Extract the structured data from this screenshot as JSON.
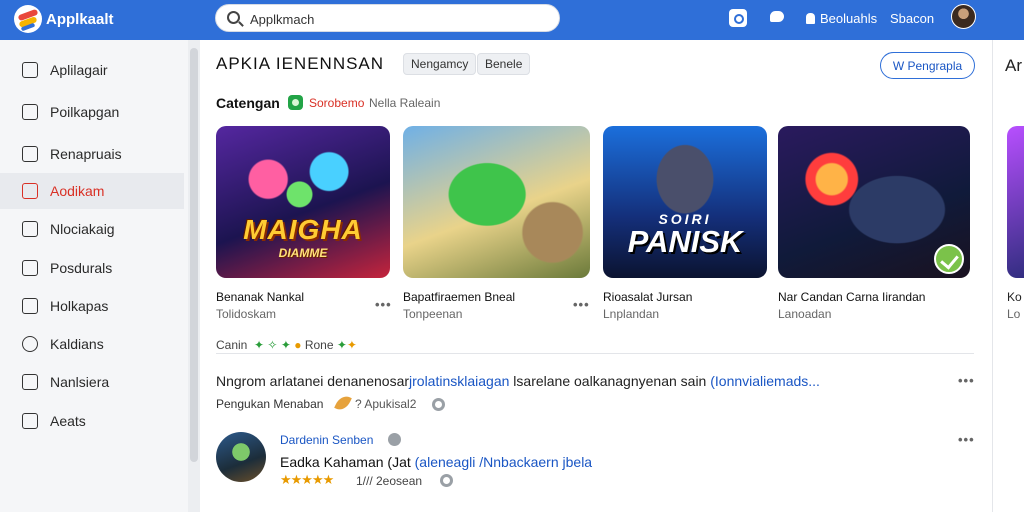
{
  "header": {
    "app_title": "Applkaalt",
    "search_value": "Applkmach",
    "links": [
      "Beoluahls",
      "Sbacon"
    ],
    "logo_icon": "app-logo-icon"
  },
  "sidebar": {
    "items": [
      {
        "label": "Aplilagair",
        "icon": "home-icon",
        "active": false
      },
      {
        "label": "Poilkapgan",
        "icon": "list-icon",
        "active": false
      },
      {
        "label": "Renapruais",
        "icon": "chart-icon",
        "active": false
      },
      {
        "label": "Aodikam",
        "icon": "apps-icon",
        "active": true
      },
      {
        "label": "Nlociakaig",
        "icon": "book-icon",
        "active": false
      },
      {
        "label": "Posdurals",
        "icon": "grid-icon",
        "active": false
      },
      {
        "label": "Holkapas",
        "icon": "store-icon",
        "active": false
      },
      {
        "label": "Kaldians",
        "icon": "settings-icon",
        "active": false
      },
      {
        "label": "Nanlsiera",
        "icon": "bookmark-icon",
        "active": false
      },
      {
        "label": "Aeats",
        "icon": "edit-icon",
        "active": false
      }
    ]
  },
  "main": {
    "title": "APKIA IENENNSAN",
    "chips": [
      "Nengamcy",
      "Benele"
    ],
    "action_button": "W Pengrapla",
    "section": {
      "title": "Catengan",
      "red_text": "Sorobemo",
      "gray_text": "Nella Raleain"
    },
    "cards": [
      {
        "name": "Benanak Nankal",
        "sub": "Tolidoskam",
        "art_line1": "MAIGHA",
        "art_line2": "DIAMME"
      },
      {
        "name": "Bapatfiraemen Bneal",
        "sub": "Tonpeenan",
        "art_line1": "",
        "art_line2": ""
      },
      {
        "name": "Rioasalat Jursan",
        "sub": "Lnplandan",
        "art_line1": "SOIRI",
        "art_line2": "PANISK"
      },
      {
        "name": "Nar Candan Carna Iirandan",
        "sub": "Lanoadan",
        "art_line1": "",
        "art_line2": ""
      },
      {
        "name": "Ko",
        "sub": "Lo",
        "art_line1": "",
        "art_line2": ""
      }
    ],
    "tag_line": {
      "prefix": "Canin",
      "suffix": "Rone"
    },
    "post": {
      "text_plain": "Nngrom arlatanei denanenosar",
      "text_link_a": "jrolatinsklaiagan",
      "text_mid": " lsarelane oalkanagnyenan sain ",
      "text_link_b": "(Ionnvialiemads...",
      "author": "Pengukan Menaban",
      "meta": "? Apukisal2"
    },
    "review": {
      "reviewer": "Dardenin Senben",
      "text_plain": "Eadka Kahaman (Jat ",
      "text_link": "(aleneagli /Nnbackaern jbela",
      "stars": "★★★★★",
      "meta": "1/// 2eosean"
    },
    "right_strip": {
      "title": "Ar",
      "line1": "Ko",
      "line2": "Lo"
    }
  }
}
